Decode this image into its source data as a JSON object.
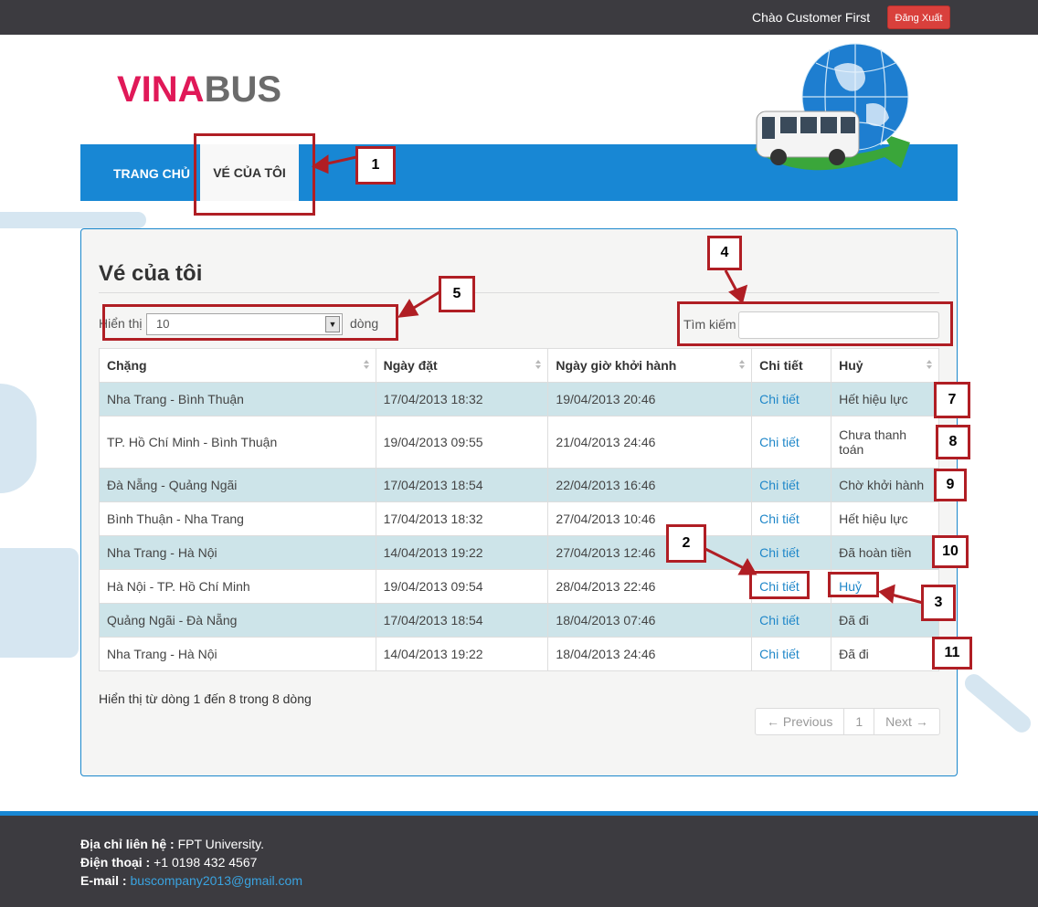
{
  "topbar": {
    "greeting": "Chào Customer First",
    "logout_label": "Đăng Xuất"
  },
  "brand": {
    "logo_part1": "VINA",
    "logo_part2": "BUS",
    "logo_color_1": "#e01958",
    "logo_color_2": "#6b6b6b"
  },
  "nav": {
    "home": "TRANG CHỦ",
    "my_tickets": "VÉ CỦA TÔI",
    "background": "#1887d4"
  },
  "page": {
    "title": "Vé của tôi",
    "show_label": "Hiển thị",
    "page_length": "10",
    "rows_label": "dòng",
    "search_label": "Tìm kiếm",
    "search_value": ""
  },
  "table": {
    "headers": [
      "Chặng",
      "Ngày đặt",
      "Ngày giờ khởi hành",
      "Chi tiết",
      "Huỷ"
    ],
    "rows": [
      {
        "route": "Nha Trang - Bình Thuận",
        "booked": "17/04/2013 18:32",
        "departure": "19/04/2013 20:46",
        "detail": "Chi tiết",
        "cancel": "Hết hiệu lực"
      },
      {
        "route": "TP. Hồ Chí Minh - Bình Thuận",
        "booked": "19/04/2013 09:55",
        "departure": "21/04/2013 24:46",
        "detail": "Chi tiết",
        "cancel": "Chưa thanh toán"
      },
      {
        "route": "Đà Nẵng - Quảng Ngãi",
        "booked": "17/04/2013 18:54",
        "departure": "22/04/2013 16:46",
        "detail": "Chi tiết",
        "cancel": "Chờ khởi hành"
      },
      {
        "route": "Bình Thuận - Nha Trang",
        "booked": "17/04/2013 18:32",
        "departure": "27/04/2013 10:46",
        "detail": "Chi tiết",
        "cancel": "Hết hiệu lực"
      },
      {
        "route": "Nha Trang - Hà Nội",
        "booked": "14/04/2013 19:22",
        "departure": "27/04/2013 12:46",
        "detail": "Chi tiết",
        "cancel": "Đã hoàn tiền"
      },
      {
        "route": "Hà Nội - TP. Hồ Chí Minh",
        "booked": "19/04/2013 09:54",
        "departure": "28/04/2013 22:46",
        "detail": "Chi tiết",
        "cancel": "Huỷ"
      },
      {
        "route": "Quảng Ngãi - Đà Nẵng",
        "booked": "17/04/2013 18:54",
        "departure": "18/04/2013 07:46",
        "detail": "Chi tiết",
        "cancel": "Đã đi"
      },
      {
        "route": "Nha Trang - Hà Nội",
        "booked": "14/04/2013 19:22",
        "departure": "18/04/2013 24:46",
        "detail": "Chi tiết",
        "cancel": "Đã đi"
      }
    ]
  },
  "info": "Hiển thị từ dòng 1 đến 8 trong 8 dòng",
  "pagination": {
    "previous": "← Previous",
    "page": "1",
    "next": "Next →"
  },
  "footer": {
    "address_label": "Địa chỉ liên hệ :",
    "address_value": " FPT University.",
    "phone_label": "Điện thoại :",
    "phone_value": " +1 0198 432 4567",
    "email_label": "E-mail :",
    "email_value": "buscompany2013@gmail.com"
  },
  "annotations": [
    "1",
    "2",
    "3",
    "4",
    "5",
    "7",
    "8",
    "9",
    "10",
    "11"
  ],
  "colors": {
    "accent_blue": "#1887d4",
    "annotation_red": "#b01e24",
    "row_stripe": "#cde4e9",
    "link": "#1f87c9",
    "logout_red": "#d9403c"
  }
}
